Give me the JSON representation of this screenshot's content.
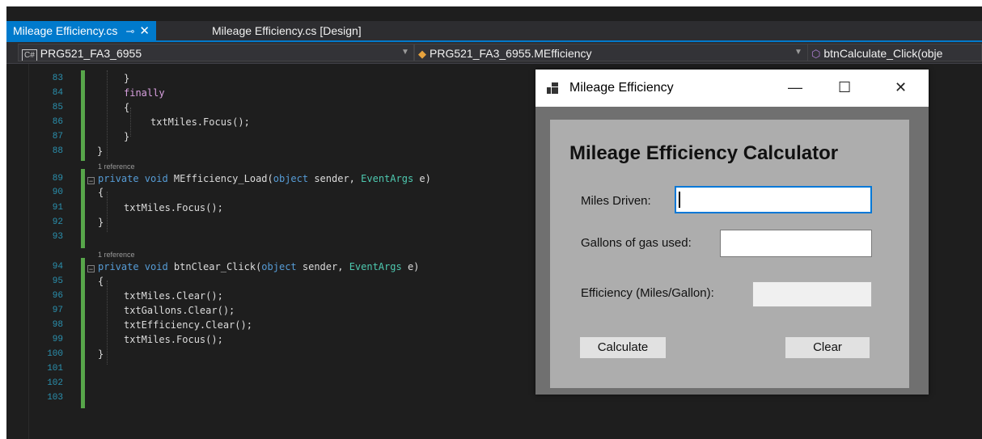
{
  "tabs": [
    {
      "label": "Mileage Efficiency.cs",
      "active": true,
      "pin_icon": "pin-icon",
      "close_icon": "close-icon"
    },
    {
      "label": "Mileage Efficiency.cs [Design]",
      "active": false
    }
  ],
  "navbar": {
    "project": "PRG521_FA3_6955",
    "class": "PRG521_FA3_6955.MEfficiency",
    "member": "btnCalculate_Click(obje"
  },
  "code_lines": [
    {
      "n": "83",
      "text": "}"
    },
    {
      "n": "84",
      "text": "finally"
    },
    {
      "n": "85",
      "text": "{"
    },
    {
      "n": "86",
      "text": "txtMiles.Focus();"
    },
    {
      "n": "87",
      "text": "}"
    },
    {
      "n": "88",
      "text": "}"
    },
    {
      "n": "89",
      "ref": "1 reference",
      "text": "private void MEfficiency_Load(object sender, EventArgs e)"
    },
    {
      "n": "90",
      "text": "{"
    },
    {
      "n": "91",
      "text": "txtMiles.Focus();"
    },
    {
      "n": "92",
      "text": "}"
    },
    {
      "n": "93",
      "text": ""
    },
    {
      "n": "94",
      "ref": "1 reference",
      "text": "private void btnClear_Click(object sender, EventArgs e)"
    },
    {
      "n": "95",
      "text": "{"
    },
    {
      "n": "96",
      "text": "txtMiles.Clear();"
    },
    {
      "n": "97",
      "text": "txtGallons.Clear();"
    },
    {
      "n": "98",
      "text": "txtEfficiency.Clear();"
    },
    {
      "n": "99",
      "text": "txtMiles.Focus();"
    },
    {
      "n": "100",
      "text": "}"
    },
    {
      "n": "101",
      "text": ""
    },
    {
      "n": "102",
      "text": ""
    },
    {
      "n": "103",
      "text": ""
    }
  ],
  "form": {
    "title": "Mileage Efficiency",
    "heading": "Mileage Efficiency Calculator",
    "miles_label": "Miles Driven:",
    "miles_value": "",
    "gallons_label": "Gallons of gas used:",
    "gallons_value": "",
    "efficiency_label": "Efficiency (Miles/Gallon):",
    "efficiency_value": "",
    "calculate_label": "Calculate",
    "clear_label": "Clear",
    "minimize": "—",
    "maximize": "☐",
    "close": "✕"
  },
  "colors": {
    "accent": "#007acc",
    "editor_bg": "#1e1e1e",
    "keyword": "#569cd6",
    "type": "#4ec9b0",
    "line_number": "#2b91af",
    "change_bar": "#57a64a"
  }
}
